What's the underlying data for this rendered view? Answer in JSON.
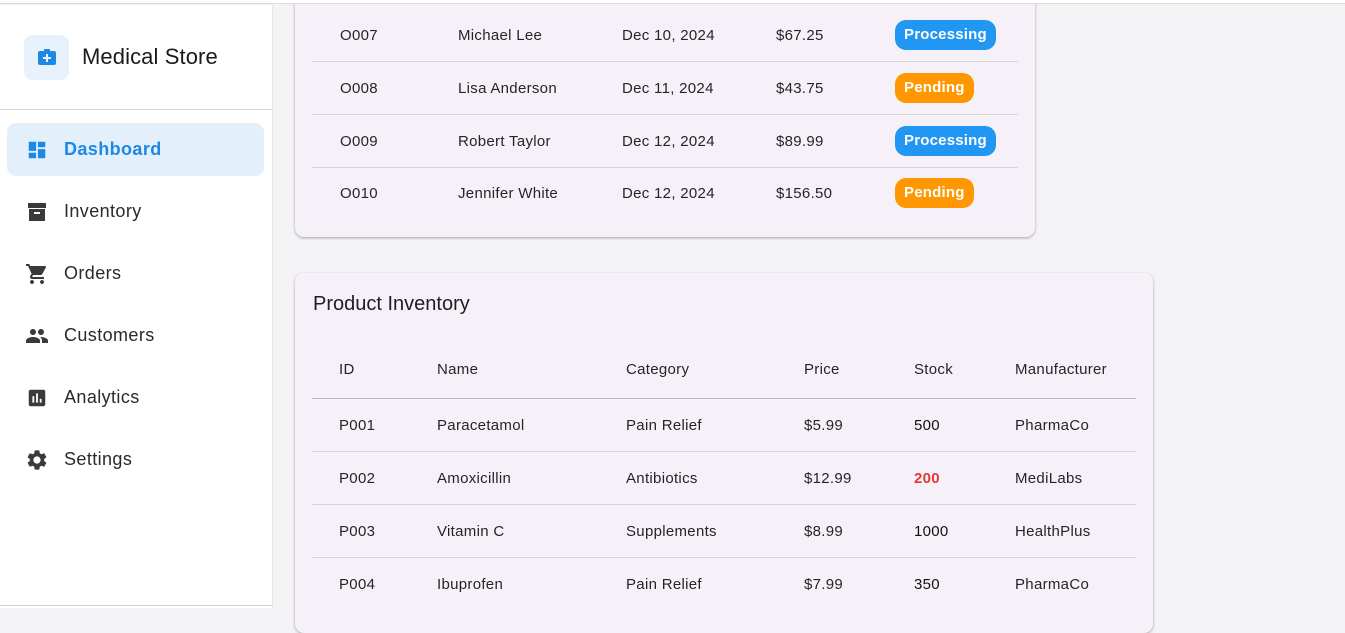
{
  "app": {
    "title": "Medical Store"
  },
  "sidebar": {
    "items": [
      {
        "label": "Dashboard",
        "icon": "dashboard-icon",
        "active": true
      },
      {
        "label": "Inventory",
        "icon": "inventory-icon",
        "active": false
      },
      {
        "label": "Orders",
        "icon": "cart-icon",
        "active": false
      },
      {
        "label": "Customers",
        "icon": "people-icon",
        "active": false
      },
      {
        "label": "Analytics",
        "icon": "analytics-icon",
        "active": false
      },
      {
        "label": "Settings",
        "icon": "gear-icon",
        "active": false
      }
    ]
  },
  "orders": {
    "rows": [
      {
        "id": "O007",
        "customer": "Michael Lee",
        "date": "Dec 10, 2024",
        "amount": "$67.25",
        "status": "Processing"
      },
      {
        "id": "O008",
        "customer": "Lisa Anderson",
        "date": "Dec 11, 2024",
        "amount": "$43.75",
        "status": "Pending"
      },
      {
        "id": "O009",
        "customer": "Robert Taylor",
        "date": "Dec 12, 2024",
        "amount": "$89.99",
        "status": "Processing"
      },
      {
        "id": "O010",
        "customer": "Jennifer White",
        "date": "Dec 12, 2024",
        "amount": "$156.50",
        "status": "Pending"
      }
    ]
  },
  "inventory": {
    "title": "Product Inventory",
    "columns": [
      "ID",
      "Name",
      "Category",
      "Price",
      "Stock",
      "Manufacturer"
    ],
    "rows": [
      {
        "id": "P001",
        "name": "Paracetamol",
        "category": "Pain Relief",
        "price": "$5.99",
        "stock": "500",
        "manufacturer": "PharmaCo",
        "low": false
      },
      {
        "id": "P002",
        "name": "Amoxicillin",
        "category": "Antibiotics",
        "price": "$12.99",
        "stock": "200",
        "manufacturer": "MediLabs",
        "low": true
      },
      {
        "id": "P003",
        "name": "Vitamin C",
        "category": "Supplements",
        "price": "$8.99",
        "stock": "1000",
        "manufacturer": "HealthPlus",
        "low": false
      },
      {
        "id": "P004",
        "name": "Ibuprofen",
        "category": "Pain Relief",
        "price": "$7.99",
        "stock": "350",
        "manufacturer": "PharmaCo",
        "low": false
      }
    ]
  },
  "colors": {
    "accent": "#1e88e5",
    "processing": "#2196f3",
    "pending": "#ff9800",
    "low_stock": "#e53935"
  }
}
